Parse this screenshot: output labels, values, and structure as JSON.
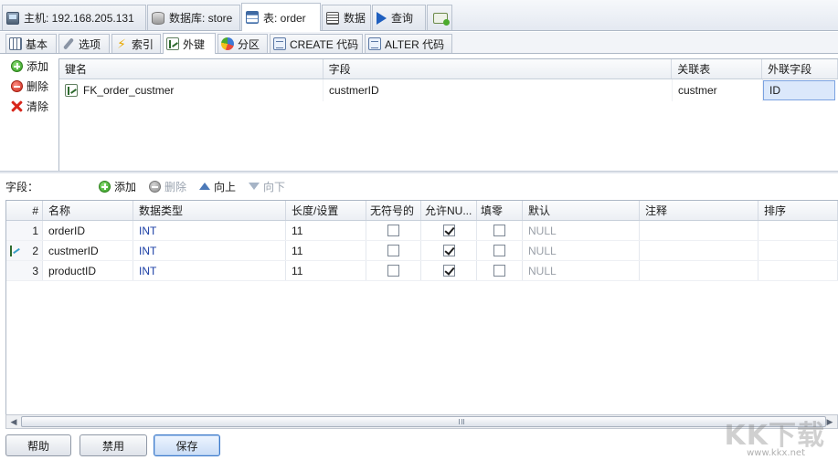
{
  "top_tabs": [
    {
      "label": "主机: 192.168.205.131",
      "icon": "host-icon"
    },
    {
      "label": "数据库: store",
      "icon": "database-icon"
    },
    {
      "label": "表: order",
      "icon": "table-icon",
      "active": true
    },
    {
      "label": "数据",
      "icon": "data-icon"
    },
    {
      "label": "查询",
      "icon": "query-icon"
    },
    {
      "label": "",
      "icon": "new-query-icon"
    }
  ],
  "sub_tabs": [
    {
      "label": "基本",
      "icon": "basic-icon"
    },
    {
      "label": "选项",
      "icon": "wrench-icon"
    },
    {
      "label": "索引",
      "icon": "index-bolt-icon"
    },
    {
      "label": "外键",
      "icon": "foreign-key-icon",
      "active": true
    },
    {
      "label": "分区",
      "icon": "partition-icon"
    },
    {
      "label": "CREATE 代码",
      "icon": "create-code-icon"
    },
    {
      "label": "ALTER 代码",
      "icon": "alter-code-icon"
    }
  ],
  "fk_actions": {
    "add": "添加",
    "delete": "删除",
    "clear": "清除"
  },
  "fk_table": {
    "headers": [
      "键名",
      "字段",
      "关联表",
      "外联字段"
    ],
    "rows": [
      {
        "key_name": "FK_order_custmer",
        "field": "custmerID",
        "ref_table": "custmer",
        "ref_field": "ID"
      }
    ]
  },
  "fields_toolbar": {
    "label": "字段：",
    "add": "添加",
    "delete": "删除",
    "up": "向上",
    "down": "向下"
  },
  "fields_table": {
    "headers": [
      "#",
      "名称",
      "数据类型",
      "长度/设置",
      "无符号的",
      "允许NU...",
      "填零",
      "默认",
      "注释",
      "排序"
    ],
    "rows": [
      {
        "num": "1",
        "name": "orderID",
        "type": "INT",
        "length": "11",
        "unsigned": false,
        "nullable": true,
        "zerofill": false,
        "default": "NULL",
        "comment": "",
        "order": ""
      },
      {
        "num": "2",
        "name": "custmerID",
        "type": "INT",
        "length": "11",
        "unsigned": false,
        "nullable": true,
        "zerofill": false,
        "default": "NULL",
        "comment": "",
        "order": "",
        "foreign_key": true
      },
      {
        "num": "3",
        "name": "productID",
        "type": "INT",
        "length": "11",
        "unsigned": false,
        "nullable": true,
        "zerofill": false,
        "default": "NULL",
        "comment": "",
        "order": ""
      }
    ]
  },
  "bottom_buttons": {
    "help": "帮助",
    "disable": "禁用",
    "save": "保存"
  },
  "watermark": {
    "text": "KK下载",
    "url": "www.kkx.net"
  },
  "colors": {
    "type_text": "#1b3fa6",
    "default_text": "#9aa0a8",
    "selection": "#dbe8fb"
  }
}
